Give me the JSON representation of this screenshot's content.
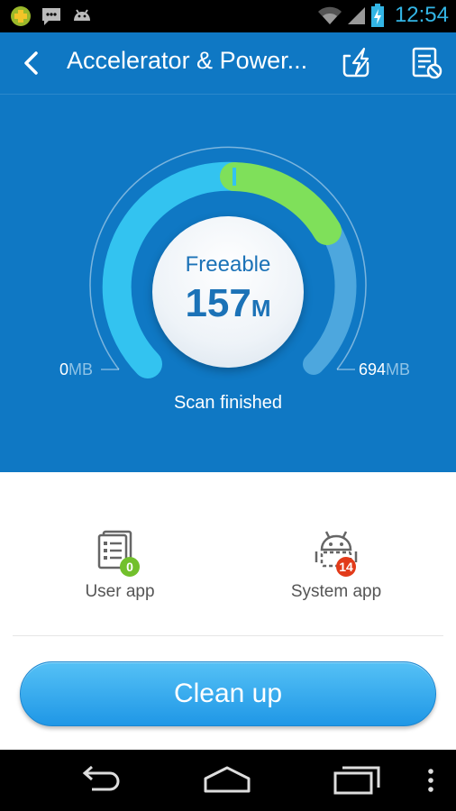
{
  "status_bar": {
    "time": "12:54",
    "icons": [
      "cross-badge-icon",
      "messaging-icon",
      "android-icon",
      "wifi-icon",
      "signal-icon",
      "battery-charging-icon"
    ]
  },
  "app_bar": {
    "title": "Accelerator & Power...",
    "actions": [
      "boost-icon",
      "ignore-list-icon"
    ]
  },
  "gauge": {
    "label": "Freeable",
    "value": "157",
    "unit": "M",
    "min_value": "0",
    "min_unit": "MB",
    "max_value": "694",
    "max_unit": "MB",
    "status": "Scan finished",
    "colors": {
      "used": "#33c3f0",
      "freeable": "#7fe05a",
      "track": "#4da7de",
      "background": "#0f78c4"
    }
  },
  "apps": {
    "user_label": "User app",
    "user_count": "0",
    "system_label": "System app",
    "system_count": "14"
  },
  "cta": {
    "label": "Clean up"
  }
}
